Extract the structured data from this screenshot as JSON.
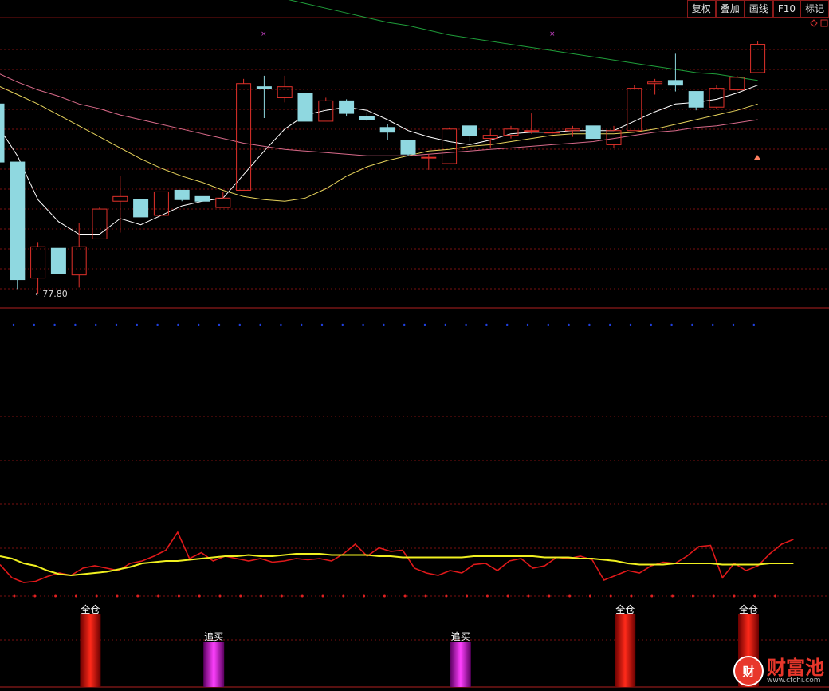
{
  "toolbar": {
    "buttons": [
      "复权",
      "叠加",
      "画线",
      "F10",
      "标记"
    ]
  },
  "icons": {
    "top_right": "diamond-icon"
  },
  "colors": {
    "up": "#e0312a",
    "down": "#8fd8e0",
    "ma5": "#ffffff",
    "ma10": "#e6d35c",
    "ma20": "#d86a8a",
    "ma60": "#1f9e3a",
    "grid": "#7a1010",
    "rsi": "#e0191a",
    "signal": "#f0f020"
  },
  "watermark": {
    "name": "财富池",
    "badge": "财",
    "url": "www.cfchi.com"
  },
  "chart_data": [
    {
      "type": "candlestick",
      "price_range": [
        77.0,
        86.0
      ],
      "low_marker_label": "←77.80",
      "low_marker_value": 77.8,
      "candles": [
        {
          "o": 83.45,
          "h": 83.9,
          "l": 81.6,
          "c": 81.6
        },
        {
          "o": 81.6,
          "h": 81.6,
          "l": 77.55,
          "c": 77.85
        },
        {
          "o": 77.9,
          "h": 79.05,
          "l": 77.4,
          "c": 78.9
        },
        {
          "o": 78.85,
          "h": 78.85,
          "l": 78.05,
          "c": 78.05
        },
        {
          "o": 78.0,
          "h": 79.65,
          "l": 77.6,
          "c": 78.9
        },
        {
          "o": 79.15,
          "h": 80.15,
          "l": 79.15,
          "c": 80.1
        },
        {
          "o": 80.35,
          "h": 81.15,
          "l": 79.35,
          "c": 80.5
        },
        {
          "o": 80.4,
          "h": 80.4,
          "l": 79.85,
          "c": 79.85
        },
        {
          "o": 79.9,
          "h": 80.65,
          "l": 79.9,
          "c": 80.65
        },
        {
          "o": 80.7,
          "h": 80.7,
          "l": 80.35,
          "c": 80.4
        },
        {
          "o": 80.5,
          "h": 80.5,
          "l": 80.35,
          "c": 80.35
        },
        {
          "o": 80.15,
          "h": 80.65,
          "l": 80.15,
          "c": 80.45
        },
        {
          "o": 80.7,
          "h": 84.25,
          "l": 80.7,
          "c": 84.1
        },
        {
          "o": 84.0,
          "h": 84.35,
          "l": 83.0,
          "c": 83.95
        },
        {
          "o": 83.65,
          "h": 84.35,
          "l": 83.5,
          "c": 84.0
        },
        {
          "o": 83.8,
          "h": 83.8,
          "l": 82.9,
          "c": 82.9
        },
        {
          "o": 82.9,
          "h": 83.65,
          "l": 82.9,
          "c": 83.55
        },
        {
          "o": 83.55,
          "h": 83.6,
          "l": 83.05,
          "c": 83.15
        },
        {
          "o": 83.05,
          "h": 83.2,
          "l": 82.9,
          "c": 82.95
        },
        {
          "o": 82.7,
          "h": 82.8,
          "l": 82.3,
          "c": 82.55
        },
        {
          "o": 82.3,
          "h": 82.3,
          "l": 81.8,
          "c": 81.85
        },
        {
          "o": 81.75,
          "h": 81.85,
          "l": 81.35,
          "c": 81.75
        },
        {
          "o": 81.55,
          "h": 82.7,
          "l": 81.55,
          "c": 82.65
        },
        {
          "o": 82.75,
          "h": 82.75,
          "l": 82.25,
          "c": 82.45
        },
        {
          "o": 82.35,
          "h": 82.65,
          "l": 82.05,
          "c": 82.45
        },
        {
          "o": 82.45,
          "h": 82.75,
          "l": 82.35,
          "c": 82.65
        },
        {
          "o": 82.6,
          "h": 83.15,
          "l": 82.5,
          "c": 82.6
        },
        {
          "o": 82.55,
          "h": 82.75,
          "l": 82.4,
          "c": 82.55
        },
        {
          "o": 82.6,
          "h": 82.75,
          "l": 82.4,
          "c": 82.65
        },
        {
          "o": 82.75,
          "h": 82.75,
          "l": 82.35,
          "c": 82.35
        },
        {
          "o": 82.15,
          "h": 82.75,
          "l": 82.05,
          "c": 82.6
        },
        {
          "o": 82.6,
          "h": 84.05,
          "l": 82.6,
          "c": 83.95
        },
        {
          "o": 84.1,
          "h": 84.25,
          "l": 83.75,
          "c": 84.15
        },
        {
          "o": 84.2,
          "h": 85.05,
          "l": 83.85,
          "c": 84.05
        },
        {
          "o": 83.85,
          "h": 83.85,
          "l": 83.25,
          "c": 83.35
        },
        {
          "o": 83.35,
          "h": 84.05,
          "l": 83.3,
          "c": 83.95
        },
        {
          "o": 83.9,
          "h": 84.35,
          "l": 83.85,
          "c": 84.3
        },
        {
          "o": 84.45,
          "h": 85.45,
          "l": 84.45,
          "c": 85.35
        }
      ],
      "ma_series": [
        {
          "key": "ma5",
          "values": [
            82.8,
            81.8,
            80.4,
            79.7,
            79.3,
            79.3,
            79.8,
            79.6,
            79.9,
            80.2,
            80.35,
            80.45,
            81.2,
            81.95,
            82.65,
            83.1,
            83.25,
            83.35,
            83.25,
            82.95,
            82.6,
            82.4,
            82.25,
            82.15,
            82.3,
            82.5,
            82.55,
            82.55,
            82.6,
            82.6,
            82.6,
            82.9,
            83.2,
            83.45,
            83.5,
            83.6,
            83.8,
            84.05
          ]
        },
        {
          "key": "ma10",
          "values": [
            84.05,
            83.75,
            83.45,
            83.1,
            82.75,
            82.4,
            82.05,
            81.7,
            81.4,
            81.15,
            80.95,
            80.7,
            80.5,
            80.4,
            80.35,
            80.45,
            80.75,
            81.15,
            81.45,
            81.65,
            81.8,
            81.95,
            82.0,
            82.1,
            82.15,
            82.25,
            82.35,
            82.45,
            82.5,
            82.5,
            82.5,
            82.55,
            82.65,
            82.8,
            82.95,
            83.1,
            83.25,
            83.45
          ]
        },
        {
          "key": "ma20",
          "values": [
            84.45,
            84.15,
            83.9,
            83.7,
            83.45,
            83.3,
            83.1,
            82.95,
            82.8,
            82.65,
            82.5,
            82.35,
            82.2,
            82.1,
            82.0,
            81.95,
            81.9,
            81.85,
            81.8,
            81.8,
            81.8,
            81.85,
            81.9,
            81.95,
            82.0,
            82.05,
            82.1,
            82.15,
            82.2,
            82.25,
            82.35,
            82.45,
            82.55,
            82.6,
            82.7,
            82.75,
            82.85,
            82.95
          ]
        },
        {
          "key": "ma60",
          "x_start": 9,
          "values": [
            87.65,
            87.45,
            87.25,
            87.1,
            86.95,
            86.8,
            86.65,
            86.5,
            86.35,
            86.2,
            86.05,
            85.95,
            85.8,
            85.65,
            85.55,
            85.45,
            85.35,
            85.25,
            85.15,
            85.05,
            84.95,
            84.85,
            84.75,
            84.65,
            84.55,
            84.45,
            84.4,
            84.3,
            84.2
          ]
        }
      ]
    },
    {
      "type": "line",
      "range": [
        0,
        100
      ],
      "series": [
        {
          "key": "rsi",
          "values": [
            55,
            44,
            40,
            41,
            45,
            48,
            46,
            52,
            54,
            52,
            50,
            56,
            58,
            62,
            67,
            82,
            60,
            65,
            58,
            62,
            60,
            58,
            60,
            57,
            58,
            60,
            59,
            60,
            58,
            64,
            72,
            62,
            69,
            66,
            67,
            52,
            48,
            46,
            50,
            48,
            55,
            56,
            50,
            58,
            60,
            52,
            54,
            61,
            60,
            62,
            59,
            42,
            46,
            50,
            48,
            54,
            57,
            56,
            62,
            70,
            71,
            44,
            56,
            50,
            54,
            64,
            72,
            76
          ]
        },
        {
          "key": "signal",
          "values": [
            62,
            60,
            56,
            54,
            50,
            47,
            46,
            47,
            48,
            49,
            51,
            53,
            56,
            57,
            58,
            58,
            59,
            60,
            61,
            62,
            62,
            63,
            62,
            62,
            63,
            64,
            64,
            64,
            63,
            63,
            63,
            63,
            62,
            62,
            61,
            61,
            61,
            61,
            61,
            61,
            62,
            62,
            62,
            62,
            62,
            62,
            61,
            61,
            61,
            60,
            60,
            59,
            58,
            56,
            55,
            55,
            55,
            56,
            56,
            56,
            56,
            55,
            55,
            55,
            55,
            56,
            56,
            56
          ]
        }
      ],
      "bars": [
        {
          "index": 3,
          "label": "全仓",
          "kind": "full"
        },
        {
          "index": 9,
          "label": "追买",
          "kind": "chase"
        },
        {
          "index": 21,
          "label": "追买",
          "kind": "chase"
        },
        {
          "index": 29,
          "label": "全仓",
          "kind": "full"
        },
        {
          "index": 35,
          "label": "全仓",
          "kind": "full"
        }
      ]
    }
  ]
}
